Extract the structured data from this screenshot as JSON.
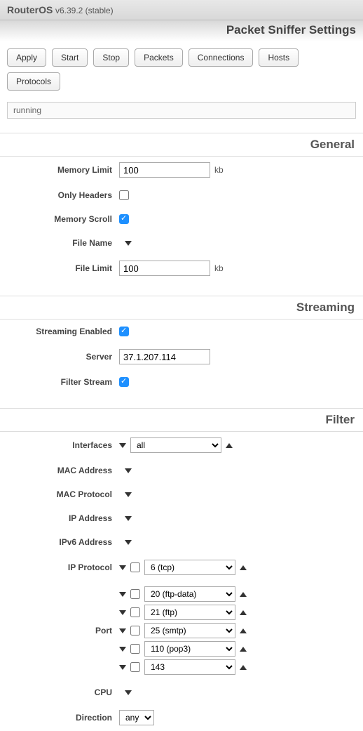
{
  "header": {
    "product": "RouterOS",
    "version": "v6.39.2 (stable)"
  },
  "page_title": "Packet Sniffer Settings",
  "toolbar": {
    "apply": "Apply",
    "start": "Start",
    "stop": "Stop",
    "packets": "Packets",
    "connections": "Connections",
    "hosts": "Hosts",
    "protocols": "Protocols"
  },
  "status": "running",
  "sections": {
    "general": "General",
    "streaming": "Streaming",
    "filter": "Filter"
  },
  "labels": {
    "memory_limit": "Memory Limit",
    "only_headers": "Only Headers",
    "memory_scroll": "Memory Scroll",
    "file_name": "File Name",
    "file_limit": "File Limit",
    "streaming_enabled": "Streaming Enabled",
    "server": "Server",
    "filter_stream": "Filter Stream",
    "interfaces": "Interfaces",
    "mac_address": "MAC Address",
    "mac_protocol": "MAC Protocol",
    "ip_address": "IP Address",
    "ipv6_address": "IPv6 Address",
    "ip_protocol": "IP Protocol",
    "port": "Port",
    "cpu": "CPU",
    "direction": "Direction",
    "kb": "kb"
  },
  "values": {
    "memory_limit": "100",
    "file_limit": "100",
    "server": "37.1.207.114",
    "interfaces": "all",
    "ip_protocol": "6 (tcp)",
    "ports": [
      "20 (ftp-data)",
      "21 (ftp)",
      "25 (smtp)",
      "110 (pop3)",
      "143"
    ],
    "direction": "any"
  }
}
